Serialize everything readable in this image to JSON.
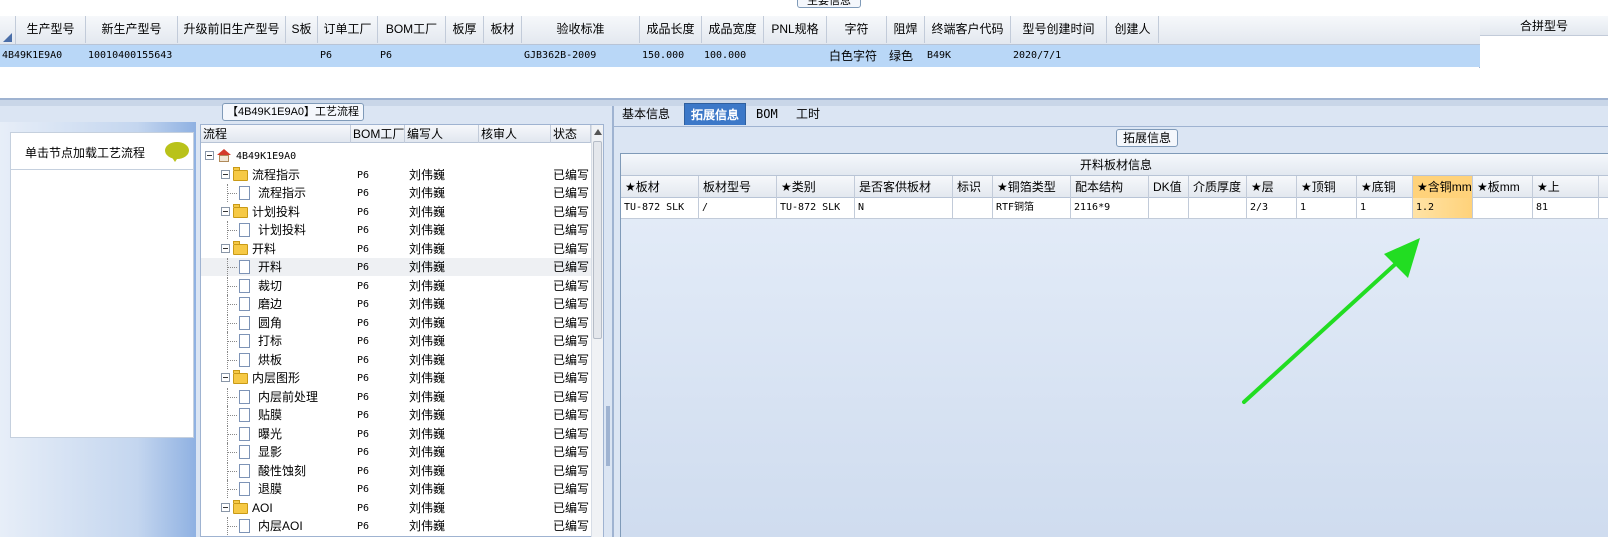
{
  "main_info": {
    "title": "主要信息",
    "columns": [
      "生产型号",
      "新生产型号",
      "升级前旧生产型号",
      "S板",
      "订单工厂",
      "BOM工厂",
      "板厚",
      "板材",
      "验收标准",
      "成品长度",
      "成品宽度",
      "PNL规格",
      "字符",
      "阻焊",
      "终端客户代码",
      "型号创建时间",
      "创建人"
    ],
    "row": [
      "4B49K1E9A0",
      "10010400155643",
      "",
      "",
      "P6",
      "P6",
      "",
      "",
      "GJB362B-2009",
      "150.000",
      "100.000",
      "",
      "白色字符",
      "绿色",
      "B49K",
      "2020/7/1",
      ""
    ],
    "side_header": "合拼型号"
  },
  "left_panel": {
    "hint": "单击节点加载工艺流程"
  },
  "process_flow": {
    "title": "【4B49K1E9A0】工艺流程",
    "columns": [
      "流程",
      "BOM工厂",
      "编写人",
      "核审人",
      "状态"
    ],
    "rows": [
      {
        "level": 0,
        "icon": "home-icon",
        "name": "4B49K1E9A0",
        "factory": "",
        "writer": "",
        "reviewer": "",
        "status": ""
      },
      {
        "level": 1,
        "icon": "folder-icon",
        "name": "流程指示",
        "factory": "P6",
        "writer": "刘伟巍",
        "reviewer": "",
        "status": "已编写"
      },
      {
        "level": 2,
        "icon": "doc-icon",
        "name": "流程指示",
        "factory": "P6",
        "writer": "刘伟巍",
        "reviewer": "",
        "status": "已编写"
      },
      {
        "level": 1,
        "icon": "folder-icon",
        "name": "计划投料",
        "factory": "P6",
        "writer": "刘伟巍",
        "reviewer": "",
        "status": "已编写"
      },
      {
        "level": 2,
        "icon": "doc-icon",
        "name": "计划投料",
        "factory": "P6",
        "writer": "刘伟巍",
        "reviewer": "",
        "status": "已编写"
      },
      {
        "level": 1,
        "icon": "folder-icon",
        "name": "开料",
        "factory": "P6",
        "writer": "刘伟巍",
        "reviewer": "",
        "status": "已编写"
      },
      {
        "level": 2,
        "icon": "doc-icon",
        "name": "开料",
        "factory": "P6",
        "writer": "刘伟巍",
        "reviewer": "",
        "status": "已编写",
        "selected": true
      },
      {
        "level": 2,
        "icon": "doc-icon",
        "name": "裁切",
        "factory": "P6",
        "writer": "刘伟巍",
        "reviewer": "",
        "status": "已编写"
      },
      {
        "level": 2,
        "icon": "doc-icon",
        "name": "磨边",
        "factory": "P6",
        "writer": "刘伟巍",
        "reviewer": "",
        "status": "已编写"
      },
      {
        "level": 2,
        "icon": "doc-icon",
        "name": "圆角",
        "factory": "P6",
        "writer": "刘伟巍",
        "reviewer": "",
        "status": "已编写"
      },
      {
        "level": 2,
        "icon": "doc-icon",
        "name": "打标",
        "factory": "P6",
        "writer": "刘伟巍",
        "reviewer": "",
        "status": "已编写"
      },
      {
        "level": 2,
        "icon": "doc-icon",
        "name": "烘板",
        "factory": "P6",
        "writer": "刘伟巍",
        "reviewer": "",
        "status": "已编写"
      },
      {
        "level": 1,
        "icon": "folder-icon",
        "name": "内层图形",
        "factory": "P6",
        "writer": "刘伟巍",
        "reviewer": "",
        "status": "已编写"
      },
      {
        "level": 2,
        "icon": "doc-icon",
        "name": "内层前处理",
        "factory": "P6",
        "writer": "刘伟巍",
        "reviewer": "",
        "status": "已编写"
      },
      {
        "level": 2,
        "icon": "doc-icon",
        "name": "贴膜",
        "factory": "P6",
        "writer": "刘伟巍",
        "reviewer": "",
        "status": "已编写"
      },
      {
        "level": 2,
        "icon": "doc-icon",
        "name": "曝光",
        "factory": "P6",
        "writer": "刘伟巍",
        "reviewer": "",
        "status": "已编写"
      },
      {
        "level": 2,
        "icon": "doc-icon",
        "name": "显影",
        "factory": "P6",
        "writer": "刘伟巍",
        "reviewer": "",
        "status": "已编写"
      },
      {
        "level": 2,
        "icon": "doc-icon",
        "name": "酸性蚀刻",
        "factory": "P6",
        "writer": "刘伟巍",
        "reviewer": "",
        "status": "已编写"
      },
      {
        "level": 2,
        "icon": "doc-icon",
        "name": "退膜",
        "factory": "P6",
        "writer": "刘伟巍",
        "reviewer": "",
        "status": "已编写"
      },
      {
        "level": 1,
        "icon": "folder-icon",
        "name": "AOI",
        "factory": "P6",
        "writer": "刘伟巍",
        "reviewer": "",
        "status": "已编写"
      },
      {
        "level": 2,
        "icon": "doc-icon",
        "name": "内层AOI",
        "factory": "P6",
        "writer": "刘伟巍",
        "reviewer": "",
        "status": "已编写"
      }
    ]
  },
  "right_panel": {
    "tabs": [
      {
        "label": "基本信息",
        "active": false
      },
      {
        "label": "拓展信息",
        "active": true
      },
      {
        "label": "BOM",
        "active": false
      },
      {
        "label": "工时",
        "active": false
      }
    ],
    "group_title": "拓展信息",
    "table_title": "开料板材信息",
    "columns": [
      "★板材",
      "板材型号",
      "★类别",
      "是否客供板材",
      "标识",
      "★铜箔类型",
      "配本结构",
      "DK值",
      "介质厚度",
      "★层",
      "★顶铜",
      "★底铜",
      "★含铜mm",
      "★板mm",
      "★上"
    ],
    "row": [
      "TU-872 SLK",
      "/",
      "TU-872 SLK",
      "N",
      "",
      "RTF铜箔",
      "2116*9",
      "",
      "",
      "2/3",
      "1",
      "1",
      "1.2",
      "",
      "81"
    ],
    "highlight_column": 12,
    "highlight_color": "#ffd27a",
    "arrow_color": "#22dd22"
  }
}
